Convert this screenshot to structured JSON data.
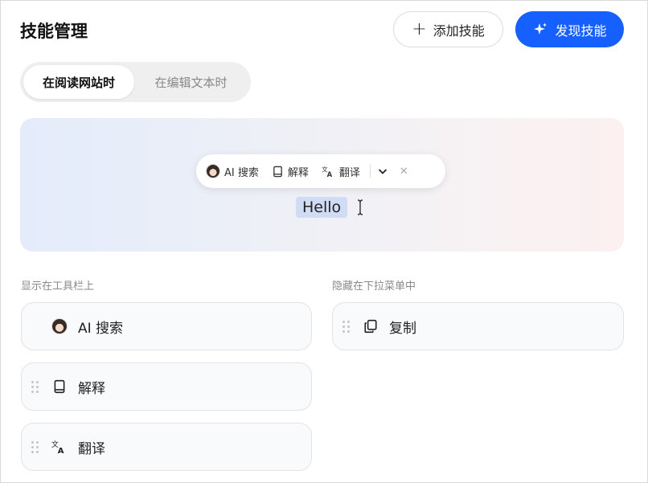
{
  "header": {
    "title": "技能管理",
    "add_label": "添加技能",
    "discover_label": "发现技能"
  },
  "tabs": [
    {
      "label": "在阅读网站时",
      "active": true
    },
    {
      "label": "在编辑文本时",
      "active": false
    }
  ],
  "preview": {
    "toolbar": [
      {
        "label": "AI 搜索",
        "icon": "ai-avatar-icon"
      },
      {
        "label": "解释",
        "icon": "book-icon"
      },
      {
        "label": "翻译",
        "icon": "translate-icon"
      }
    ],
    "selected_text": "Hello"
  },
  "shown_section": {
    "label": "显示在工具栏上",
    "items": [
      {
        "label": "AI 搜索",
        "icon": "ai-avatar-icon"
      },
      {
        "label": "解释",
        "icon": "book-icon"
      },
      {
        "label": "翻译",
        "icon": "translate-icon"
      }
    ]
  },
  "hidden_section": {
    "label": "隐藏在下拉菜单中",
    "items": [
      {
        "label": "复制",
        "icon": "copy-icon"
      }
    ]
  },
  "colors": {
    "accent": "#1660ff",
    "selection": "#cfdcf3"
  }
}
